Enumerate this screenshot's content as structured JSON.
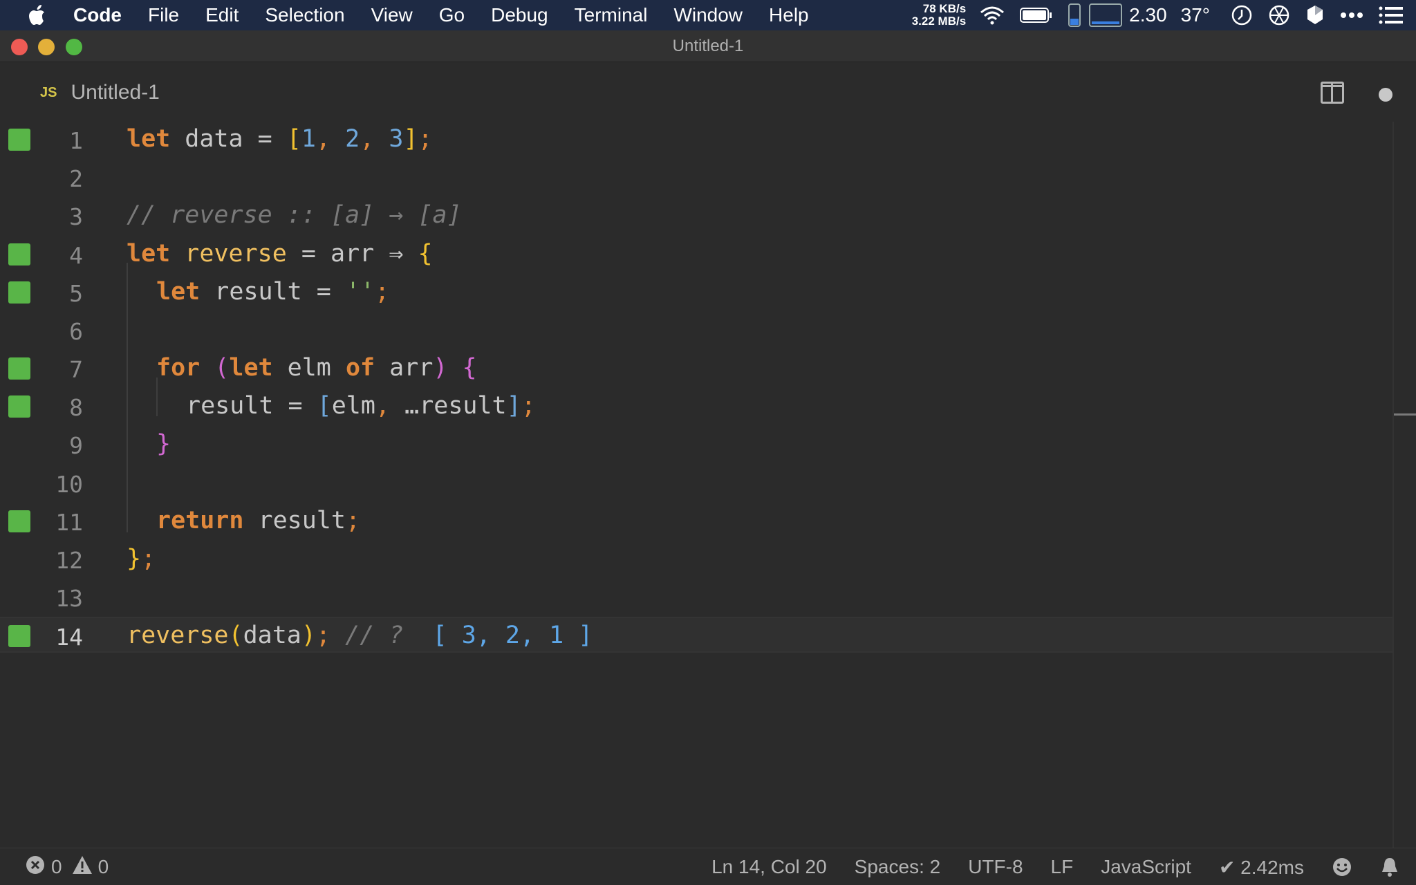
{
  "menubar": {
    "items": [
      "Code",
      "File",
      "Edit",
      "Selection",
      "View",
      "Go",
      "Debug",
      "Terminal",
      "Window",
      "Help"
    ],
    "net_up": "78 KB/s",
    "net_down": "3.22 MB/s",
    "load": "2.30",
    "temperature": "37°"
  },
  "window": {
    "title": "Untitled-1"
  },
  "tab": {
    "language_badge": "JS",
    "label": "Untitled-1"
  },
  "editor": {
    "current_line": 14,
    "lines": [
      {
        "n": "1",
        "modified": true
      },
      {
        "n": "2",
        "modified": false
      },
      {
        "n": "3",
        "modified": false
      },
      {
        "n": "4",
        "modified": true
      },
      {
        "n": "5",
        "modified": true
      },
      {
        "n": "6",
        "modified": false
      },
      {
        "n": "7",
        "modified": true
      },
      {
        "n": "8",
        "modified": true
      },
      {
        "n": "9",
        "modified": false
      },
      {
        "n": "10",
        "modified": false
      },
      {
        "n": "11",
        "modified": true
      },
      {
        "n": "12",
        "modified": false
      },
      {
        "n": "13",
        "modified": false
      },
      {
        "n": "14",
        "modified": true
      }
    ],
    "code": {
      "l1": {
        "let": "let",
        "name": "data",
        "eq": " = ",
        "open": "[",
        "a": "1",
        "c1": ", ",
        "b": "2",
        "c2": ", ",
        "c": "3",
        "close": "]",
        "semi": ";"
      },
      "l3": {
        "comment": "// reverse :: [a] → [a]"
      },
      "l4": {
        "let": "let",
        "name": "reverse",
        "eq": " = ",
        "arg": "arr",
        "arrow": " ⇒ ",
        "brace": "{"
      },
      "l5": {
        "let": "let",
        "name": "result",
        "eq": " = ",
        "str": "''",
        "semi": ";"
      },
      "l7": {
        "for": "for",
        "open": " (",
        "let": "let",
        "elm": " elm ",
        "of": "of",
        "arr": " arr",
        "close": ")",
        "brace": " {"
      },
      "l8": {
        "name": "result",
        "eq": " = ",
        "open": "[",
        "elm": "elm",
        "comma": ", ",
        "spread": "…",
        "rest": "result",
        "close": "]",
        "semi": ";"
      },
      "l9": {
        "brace": "}"
      },
      "l11": {
        "ret": "return",
        "name": " result",
        "semi": ";"
      },
      "l12": {
        "brace": "}",
        "semi": ";"
      },
      "l14": {
        "fn": "reverse",
        "open": "(",
        "arg": "data",
        "close": ")",
        "semi": ";",
        "comment": " // ? ",
        "result": " [ 3, 2, 1 ]"
      }
    }
  },
  "statusbar": {
    "errors": "0",
    "warnings": "0",
    "position": "Ln 14, Col 20",
    "spaces": "Spaces: 2",
    "encoding": "UTF-8",
    "eol": "LF",
    "language": "JavaScript",
    "timing": "✔ 2.42ms"
  },
  "colors": {
    "menubar_bg": "#1e2a44",
    "editor_bg": "#2b2b2b",
    "gutter_mark": "#59b548",
    "keyword": "#e0883c",
    "number": "#6fa8dc"
  }
}
